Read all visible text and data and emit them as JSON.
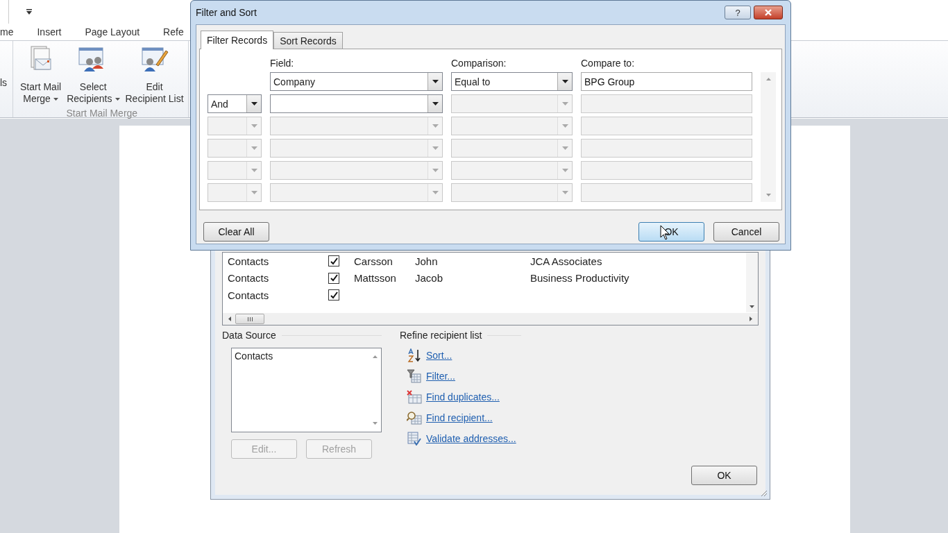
{
  "ribbon": {
    "tabs": [
      {
        "label": "me",
        "selected": false
      },
      {
        "label": "Insert",
        "selected": false
      },
      {
        "label": "Page Layout",
        "selected": false
      },
      {
        "label": "Refe",
        "selected": false
      }
    ],
    "cut_button": "ls",
    "buttons": [
      {
        "kind": "start-mail-merge",
        "lines": [
          "Start Mail",
          "Merge"
        ],
        "dropdown": true
      },
      {
        "kind": "select-recipients",
        "lines": [
          "Select",
          "Recipients"
        ],
        "dropdown": true
      },
      {
        "kind": "edit-recipient-list",
        "lines": [
          "Edit",
          "Recipient List"
        ],
        "dropdown": false
      }
    ],
    "group_label": "Start Mail Merge"
  },
  "recipients_dialog": {
    "rows": [
      {
        "source": "Contacts",
        "checked": true,
        "last_name": "Carsson",
        "first_name": "John",
        "company": "JCA Associates"
      },
      {
        "source": "Contacts",
        "checked": true,
        "last_name": "Mattsson",
        "first_name": "Jacob",
        "company": "Business Productivity"
      },
      {
        "source": "Contacts",
        "checked": true
      }
    ],
    "data_source": {
      "label": "Data Source",
      "items": [
        "Contacts"
      ],
      "buttons": [
        {
          "label": "Edit...",
          "disabled": true
        },
        {
          "label": "Refresh",
          "disabled": true
        }
      ]
    },
    "refine": {
      "label": "Refine recipient list",
      "links": [
        {
          "kind": "sort",
          "label": "Sort..."
        },
        {
          "kind": "filter",
          "label": "Filter..."
        },
        {
          "kind": "duplicates",
          "label": "Find duplicates..."
        },
        {
          "kind": "find",
          "label": "Find recipient..."
        },
        {
          "kind": "validate",
          "label": "Validate addresses..."
        }
      ]
    },
    "ok": "OK"
  },
  "filter_dialog": {
    "title": "Filter and Sort",
    "help": "?",
    "tabs": [
      {
        "label": "Filter Records",
        "selected": true
      },
      {
        "label": "Sort Records",
        "selected": false
      }
    ],
    "headers": {
      "field": "Field:",
      "comparison": "Comparison:",
      "compare_to": "Compare to:"
    },
    "rows": [
      {
        "field": "Company",
        "field_enabled": true,
        "comparison": "Equal to",
        "comparison_enabled": true,
        "compare_to": "BPG Group",
        "compare_enabled": true
      },
      {
        "conjunction": "And",
        "conjunction_enabled": true,
        "field_enabled": true,
        "comparison_enabled": false,
        "compare_enabled": false
      },
      {
        "conjunction_enabled": false,
        "field_enabled": false,
        "comparison_enabled": false,
        "compare_enabled": false
      },
      {
        "conjunction_enabled": false,
        "field_enabled": false,
        "comparison_enabled": false,
        "compare_enabled": false
      },
      {
        "conjunction_enabled": false,
        "field_enabled": false,
        "comparison_enabled": false,
        "compare_enabled": false
      },
      {
        "conjunction_enabled": false,
        "field_enabled": false,
        "comparison_enabled": false,
        "compare_enabled": false
      }
    ],
    "buttons": {
      "clear_all": "Clear All",
      "ok": "OK",
      "cancel": "Cancel"
    }
  }
}
